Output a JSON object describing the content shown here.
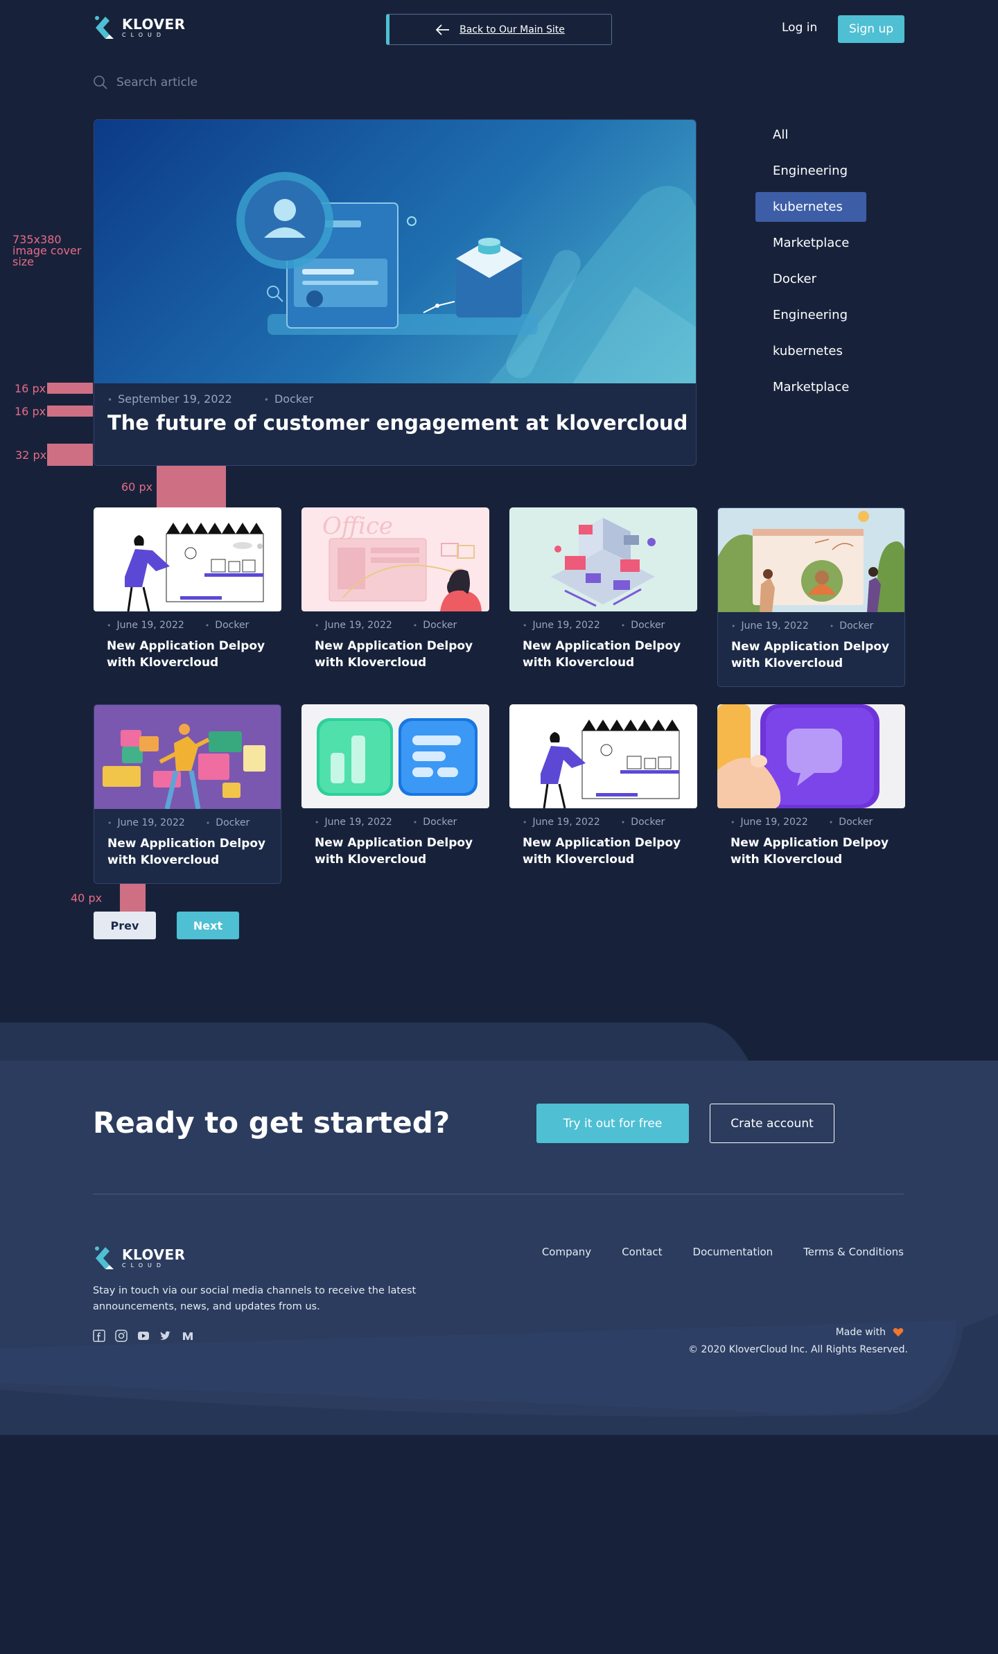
{
  "header": {
    "logo_word": "KLOVER",
    "logo_sub": "CLOUD",
    "back_label": "Back to Our Main Site",
    "login_label": "Log in",
    "signup_label": "Sign up"
  },
  "search": {
    "placeholder": "Search article"
  },
  "featured": {
    "date": "September 19, 2022",
    "tag": "Docker",
    "title": "The future of customer engagement at klovercloud"
  },
  "categories": [
    {
      "label": "All",
      "active": false
    },
    {
      "label": "Engineering",
      "active": false
    },
    {
      "label": "kubernetes",
      "active": true
    },
    {
      "label": "Marketplace",
      "active": false
    },
    {
      "label": "Docker",
      "active": false
    },
    {
      "label": "Engineering",
      "active": false
    },
    {
      "label": "kubernetes",
      "active": false
    },
    {
      "label": "Marketplace",
      "active": false
    }
  ],
  "annotations": {
    "cover_size": "735x380 image cover size",
    "gap_16a": "16 px",
    "gap_16b": "16 px",
    "gap_32": "32 px",
    "gap_60": "60 px",
    "gap_40": "40 px"
  },
  "cards": [
    {
      "date": "June 19, 2022",
      "tag": "Docker",
      "title": "New Application Delpoy with Klovercloud",
      "boxed": false
    },
    {
      "date": "June 19, 2022",
      "tag": "Docker",
      "title": "New Application Delpoy with Klovercloud",
      "boxed": false
    },
    {
      "date": "June 19, 2022",
      "tag": "Docker",
      "title": "New Application Delpoy with Klovercloud",
      "boxed": false
    },
    {
      "date": "June 19, 2022",
      "tag": "Docker",
      "title": "New Application Delpoy with Klovercloud",
      "boxed": true
    },
    {
      "date": "June 19, 2022",
      "tag": "Docker",
      "title": "New Application Delpoy with Klovercloud",
      "boxed": true
    },
    {
      "date": "June 19, 2022",
      "tag": "Docker",
      "title": "New Application Delpoy with Klovercloud",
      "boxed": false
    },
    {
      "date": "June 19, 2022",
      "tag": "Docker",
      "title": "New Application Delpoy with Klovercloud",
      "boxed": false
    },
    {
      "date": "June 19, 2022",
      "tag": "Docker",
      "title": "New Application Delpoy with Klovercloud",
      "boxed": false
    }
  ],
  "pagination": {
    "prev_label": "Prev",
    "next_label": "Next"
  },
  "footer": {
    "cta_title": "Ready to get started?",
    "try_label": "Try it out for free",
    "create_label": "Crate account",
    "tagline": "Stay in touch via our social media channels to receive the latest announcements, news, and updates from us.",
    "links": [
      "Company",
      "Contact",
      "Documentation",
      "Terms & Conditions"
    ],
    "made_with": "Made with",
    "copyright": "© 2020 KloverCloud Inc. All Rights Reserved.",
    "socials": [
      "facebook-icon",
      "instagram-icon",
      "youtube-icon",
      "twitter-icon",
      "medium-icon"
    ]
  },
  "colors": {
    "accent": "#4fbfd3",
    "bg": "#17223a",
    "active_cat": "#3d5ea7",
    "annotation": "#e96b86"
  }
}
